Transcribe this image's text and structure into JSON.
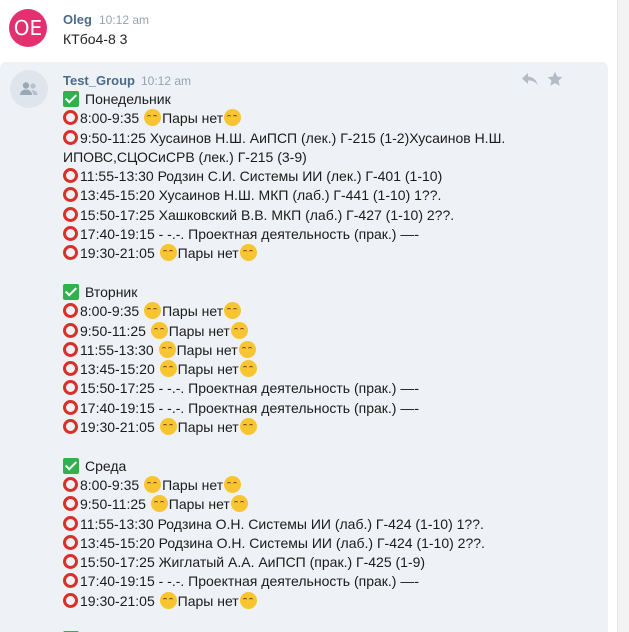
{
  "own_message": {
    "avatar_initials": "OE",
    "author": "Oleg",
    "time": "10:12 am",
    "text": "КТбо4-8 3"
  },
  "group_message": {
    "author": "Test_Group",
    "time": "10:12 am",
    "days": [
      {
        "title": "Понедельник",
        "lines": [
          {
            "text": "8:00-9:35 ",
            "emoji": true,
            "after": "Пары нет",
            "emoji_end": true
          },
          {
            "text": "9:50-11:25 Хусаинов Н.Ш. АиПСП (лек.) Г-215 (1-2)Хусаинов Н.Ш. ИПОВС,СЦОСиСРВ (лек.) Г-215 (3-9)",
            "wrap": true
          },
          {
            "text": "11:55-13:30 Родзин С.И. Системы ИИ (лек.) Г-401 (1-10)"
          },
          {
            "text": "13:45-15:20 Хусаинов Н.Ш. МКП (лаб.) Г-441 (1-10) 1??."
          },
          {
            "text": "15:50-17:25 Хашковский В.В. МКП (лаб.) Г-427 (1-10) 2??."
          },
          {
            "text": "17:40-19:15 - -.-. Проектная деятельность (прак.) —-"
          },
          {
            "text": "19:30-21:05 ",
            "emoji": true,
            "after": "Пары нет",
            "emoji_end": true
          }
        ]
      },
      {
        "title": "Вторник",
        "lines": [
          {
            "text": "8:00-9:35 ",
            "emoji": true,
            "after": "Пары нет",
            "emoji_end": true
          },
          {
            "text": "9:50-11:25 ",
            "emoji": true,
            "after": "Пары нет",
            "emoji_end": true
          },
          {
            "text": "11:55-13:30 ",
            "emoji": true,
            "after": "Пары нет",
            "emoji_end": true
          },
          {
            "text": "13:45-15:20 ",
            "emoji": true,
            "after": "Пары нет",
            "emoji_end": true
          },
          {
            "text": "15:50-17:25 - -.-. Проектная деятельность (прак.) —-"
          },
          {
            "text": "17:40-19:15 - -.-. Проектная деятельность (прак.) —-"
          },
          {
            "text": "19:30-21:05 ",
            "emoji": true,
            "after": "Пары нет",
            "emoji_end": true
          }
        ]
      },
      {
        "title": "Среда",
        "lines": [
          {
            "text": "8:00-9:35 ",
            "emoji": true,
            "after": "Пары нет",
            "emoji_end": true
          },
          {
            "text": "9:50-11:25 ",
            "emoji": true,
            "after": "Пары нет",
            "emoji_end": true
          },
          {
            "text": "11:55-13:30 Родзина О.Н. Системы ИИ (лаб.) Г-424 (1-10) 1??."
          },
          {
            "text": "13:45-15:20 Родзина О.Н. Системы ИИ (лаб.) Г-424 (1-10) 2??."
          },
          {
            "text": "15:50-17:25 Жиглатый А.А. АиПСП (прак.) Г-425 (1-9)"
          },
          {
            "text": "17:40-19:15 - -.-. Проектная деятельность (прак.) —-"
          },
          {
            "text": "19:30-21:05 ",
            "emoji": true,
            "after": "Пары нет",
            "emoji_end": true
          }
        ]
      }
    ]
  },
  "icons": {
    "reply": "reply-icon",
    "star": "star-icon",
    "group_avatar": "group-users-icon",
    "check": "check-mark-icon",
    "ring": "red-circle-icon",
    "emoji": "flushed-face-icon"
  },
  "colors": {
    "author": "#4a6b8a",
    "time": "#9aa3ad",
    "group_bg": "#eef1f5",
    "avatar": "#e4306e",
    "check": "#2fb24c",
    "ring": "#d8302b"
  }
}
